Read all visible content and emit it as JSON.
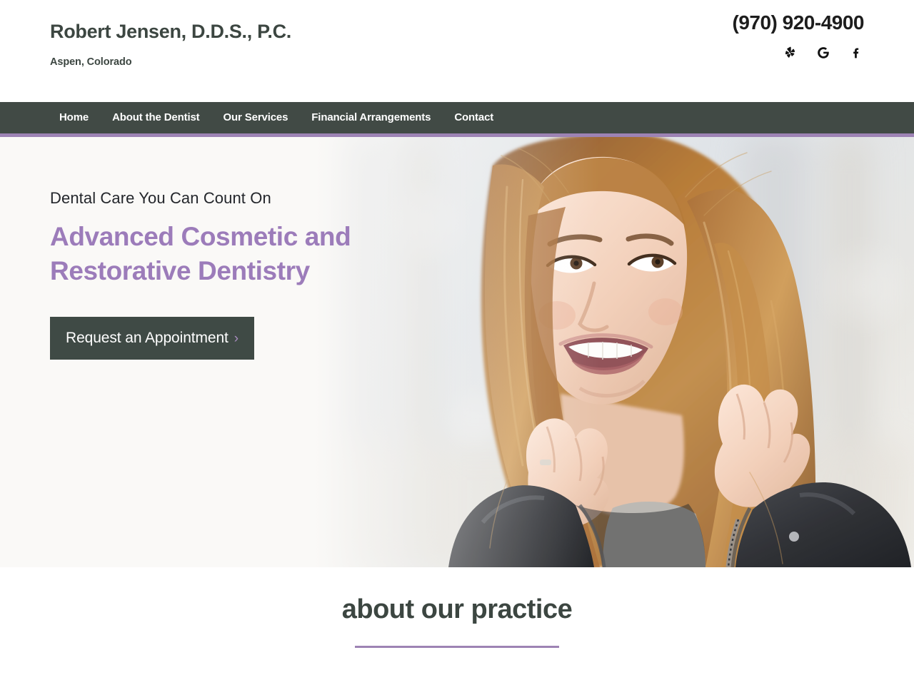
{
  "header": {
    "brand_title": "Robert Jensen, D.D.S., P.C.",
    "brand_subtitle": "Aspen, Colorado",
    "phone": "(970) 920-4900",
    "social": [
      {
        "name": "yelp-icon",
        "label": "Yelp"
      },
      {
        "name": "google-icon",
        "label": "Google"
      },
      {
        "name": "facebook-icon",
        "label": "Facebook"
      }
    ]
  },
  "nav": {
    "items": [
      {
        "label": "Home"
      },
      {
        "label": "About the Dentist"
      },
      {
        "label": "Our Services"
      },
      {
        "label": "Financial Arrangements"
      },
      {
        "label": "Contact"
      }
    ]
  },
  "hero": {
    "eyebrow": "Dental Care You Can Count On",
    "headline_line1": "Advanced Cosmetic and",
    "headline_line2": "Restorative Dentistry",
    "cta_label": "Request an Appointment",
    "cta_chevron": "›",
    "image_alt": "Smiling woman with auburn hair wearing a black leather jacket, hands near her face, blurred bright outdoor background"
  },
  "about": {
    "heading": "about our practice"
  },
  "colors": {
    "nav_background": "#414A45",
    "accent_purple": "#9D83B4",
    "headline_purple": "#9C7CBA",
    "dark_slate": "#3C4641",
    "hero_background": "#FAF9F7",
    "page_background": "#FFFFFF",
    "cta_background": "#3F4A45"
  }
}
